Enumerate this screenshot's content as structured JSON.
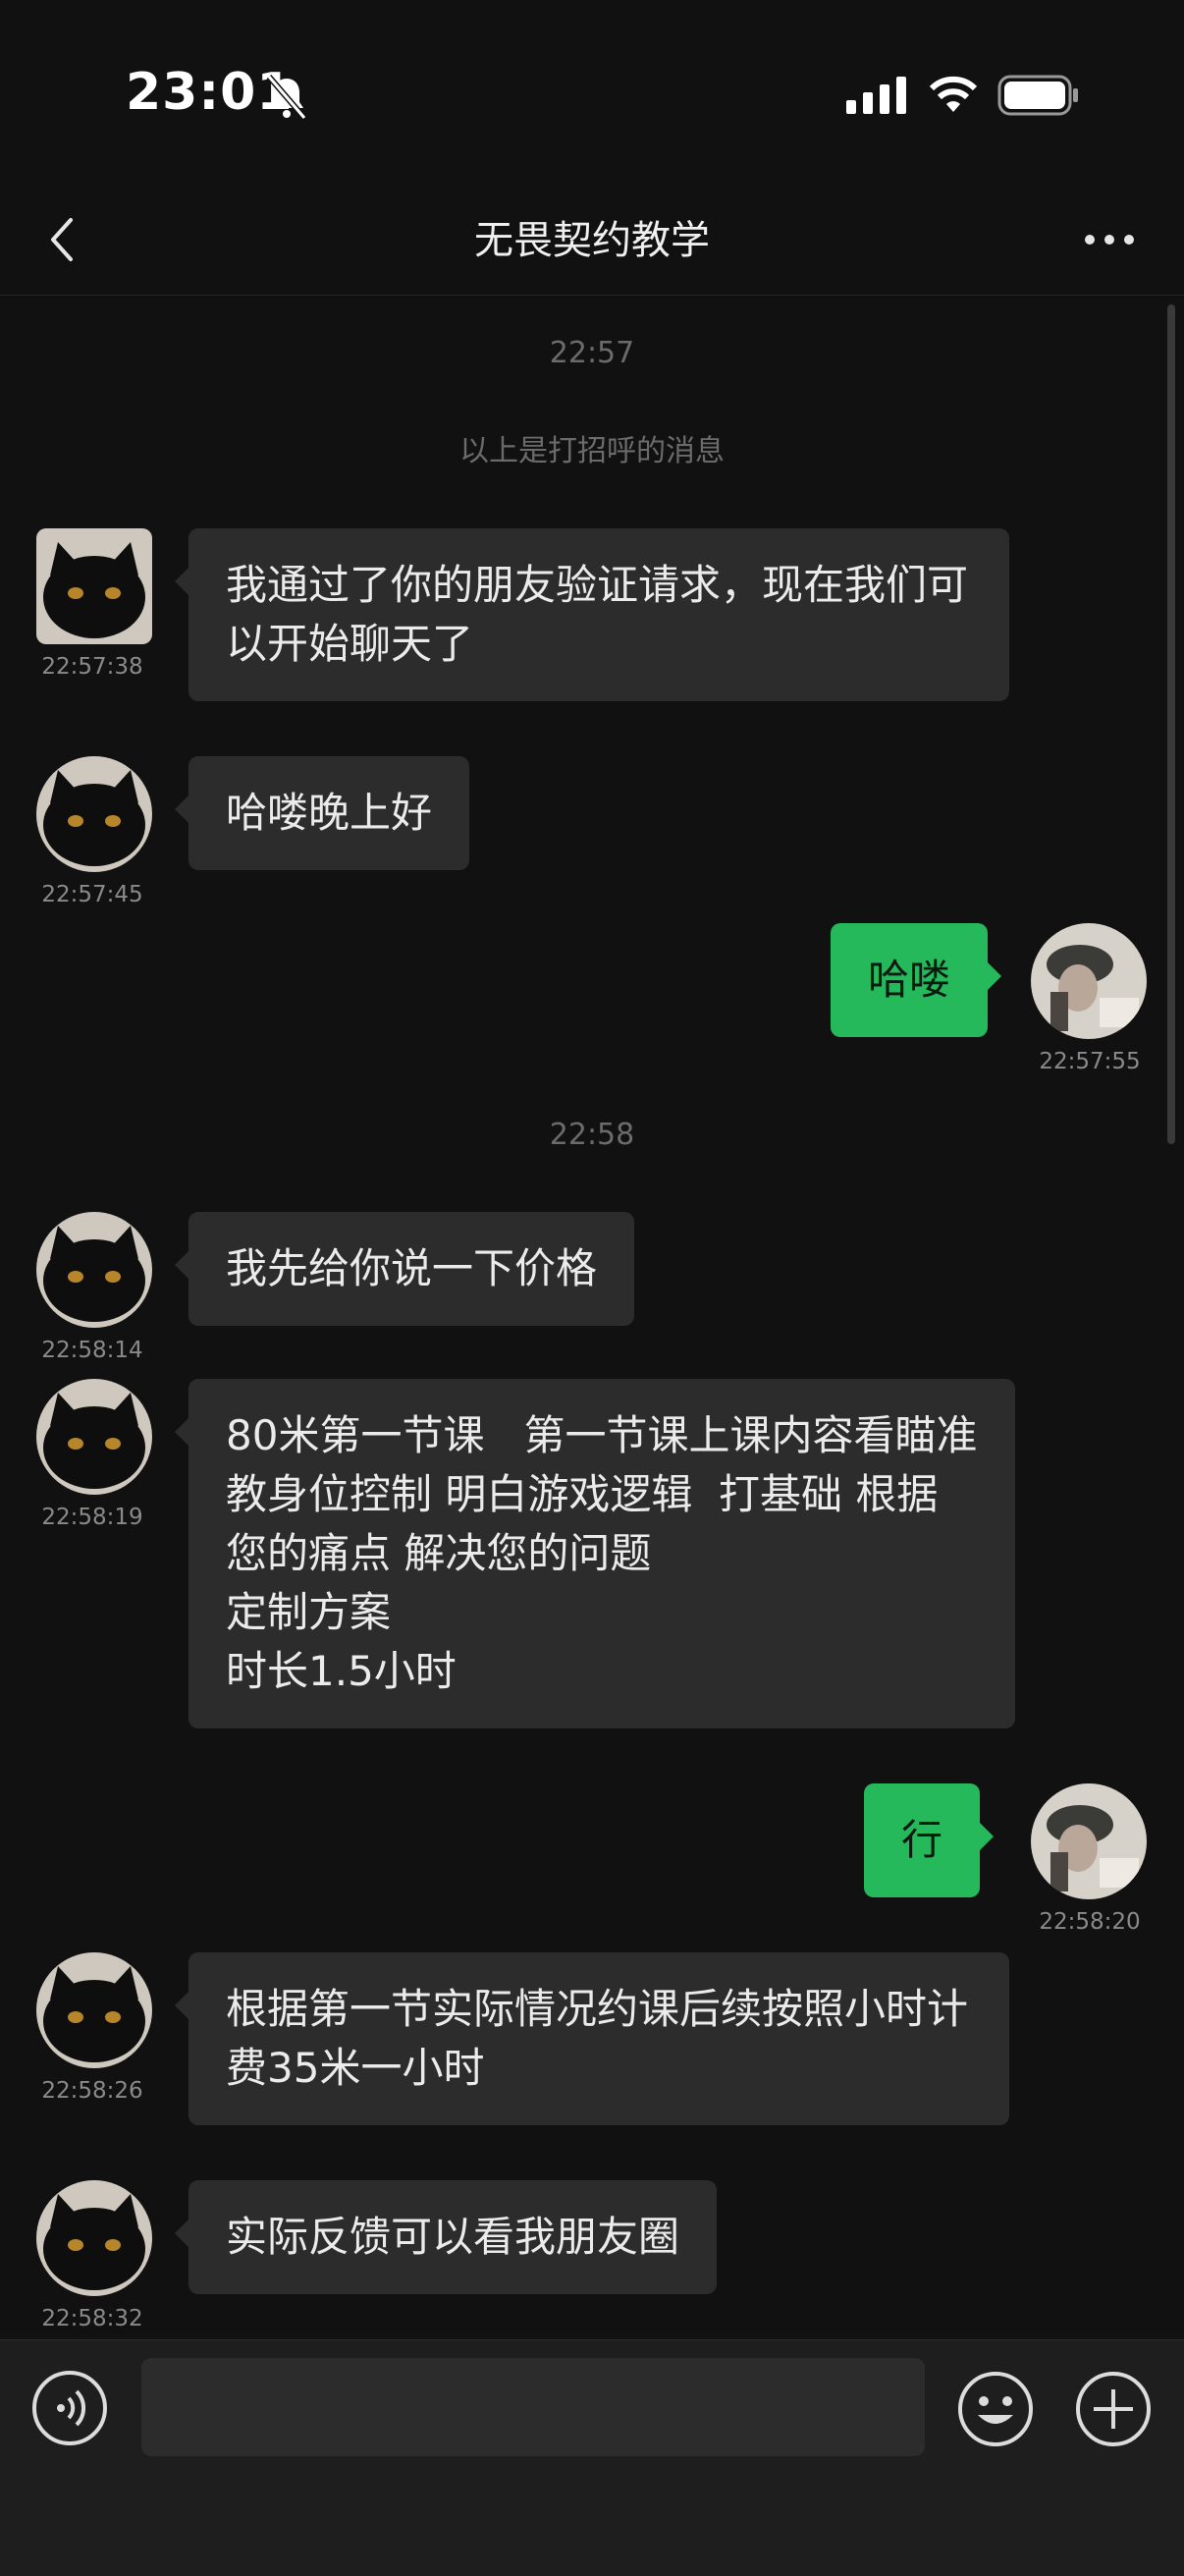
{
  "status": {
    "time": "23:01"
  },
  "header": {
    "title": "无畏契约教学"
  },
  "chat": {
    "time_divider_1": "22:57",
    "system_note": "以上是打招呼的消息",
    "time_divider_2": "22:58",
    "messages": [
      {
        "side": "left",
        "text": "我通过了你的朋友验证请求，现在我们可以开始聊天了",
        "time": "22:57:38"
      },
      {
        "side": "left",
        "text": "哈喽晚上好",
        "time": "22:57:45"
      },
      {
        "side": "right",
        "text": "哈喽",
        "time": "22:57:55"
      },
      {
        "side": "left",
        "text": "我先给你说一下价格",
        "time": "22:58:14"
      },
      {
        "side": "left",
        "text": "80米第一节课   第一节课上课内容看瞄准 教身位控制 明白游戏逻辑  打基础 根据您的痛点 解决您的问题\n定制方案\n时长1.5小时",
        "time": "22:58:19"
      },
      {
        "side": "right",
        "text": "行",
        "time": "22:58:20"
      },
      {
        "side": "left",
        "text": "根据第一节实际情况约课后续按照小时计费35米一小时",
        "time": "22:58:26"
      },
      {
        "side": "left",
        "text": "实际反馈可以看我朋友圈",
        "time": "22:58:32"
      }
    ]
  },
  "input": {
    "placeholder": ""
  },
  "icons": {
    "back": "chevron-left-icon",
    "more": "more-dots-icon",
    "voice": "voice-icon",
    "emoji": "emoji-icon",
    "plus": "plus-icon"
  },
  "colors": {
    "background": "#111111",
    "bubble_in": "#2c2c2c",
    "bubble_out": "#26b95c"
  }
}
